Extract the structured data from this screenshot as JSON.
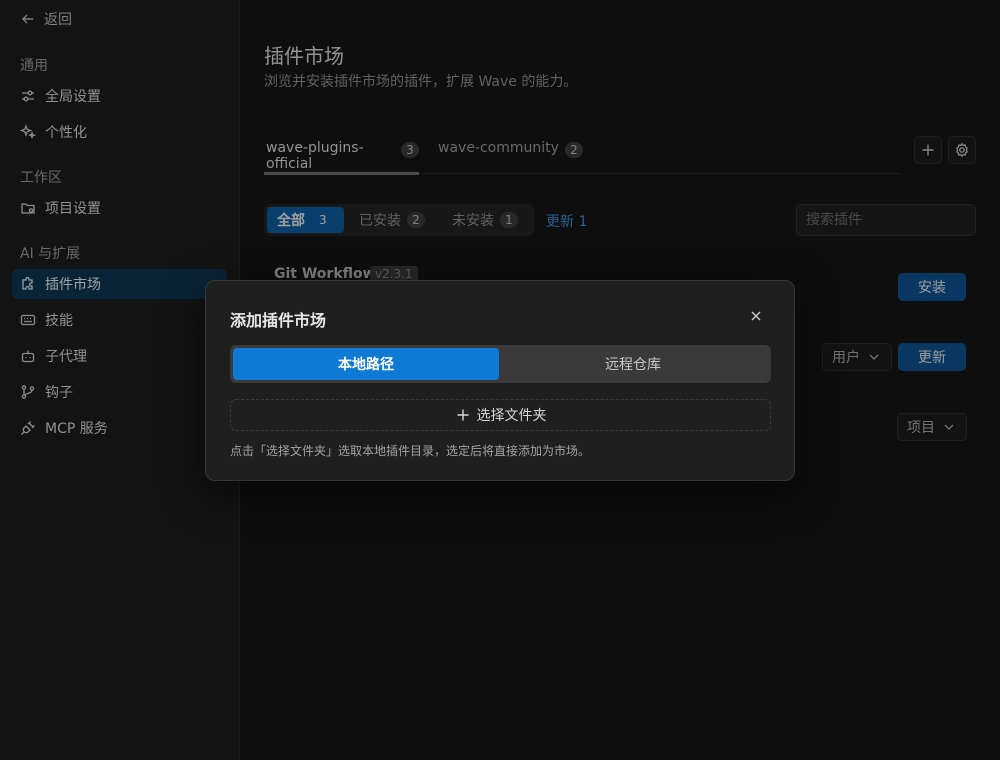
{
  "sidebar": {
    "back_label": "返回",
    "groups": [
      {
        "title": "通用",
        "items": [
          {
            "label": "全局设置",
            "icon": "sliders-icon"
          },
          {
            "label": "个性化",
            "icon": "sparkles-icon"
          }
        ]
      },
      {
        "title": "工作区",
        "items": [
          {
            "label": "项目设置",
            "icon": "folder-gear-icon"
          }
        ]
      },
      {
        "title": "AI 与扩展",
        "items": [
          {
            "label": "插件市场",
            "icon": "puzzle-icon",
            "active": true
          },
          {
            "label": "技能",
            "icon": "keyboard-icon"
          },
          {
            "label": "子代理",
            "icon": "bot-icon"
          },
          {
            "label": "钩子",
            "icon": "git-branch-icon"
          },
          {
            "label": "MCP 服务",
            "icon": "plug-icon"
          }
        ]
      }
    ]
  },
  "main": {
    "title": "插件市场",
    "subtitle": "浏览并安装插件市场的插件，扩展 Wave 的能力。",
    "tabs": [
      {
        "label": "wave-plugins-official",
        "count": "3"
      },
      {
        "label": "wave-community",
        "count": "2"
      }
    ],
    "filters": [
      {
        "label": "全部",
        "count": "3"
      },
      {
        "label": "已安装",
        "count": "2"
      },
      {
        "label": "未安装",
        "count": "1"
      }
    ],
    "update_link": "更新 1",
    "search_placeholder": "搜索插件",
    "plugin": {
      "name": "Git Workflow",
      "version": "v2.3.1"
    },
    "install_label": "安装",
    "update_label": "更新",
    "scope_user": "用户",
    "scope_project": "项目"
  },
  "modal": {
    "title": "添加插件市场",
    "options": [
      "本地路径",
      "远程仓库"
    ],
    "choose_folder": "选择文件夹",
    "hint": "点击「选择文件夹」选取本地插件目录，选定后将直接添加为市场。"
  },
  "colors": {
    "accent": "#0f7ad4",
    "accent_dark": "#0d5390",
    "background": "#161616",
    "link": "#3f8fd6"
  }
}
